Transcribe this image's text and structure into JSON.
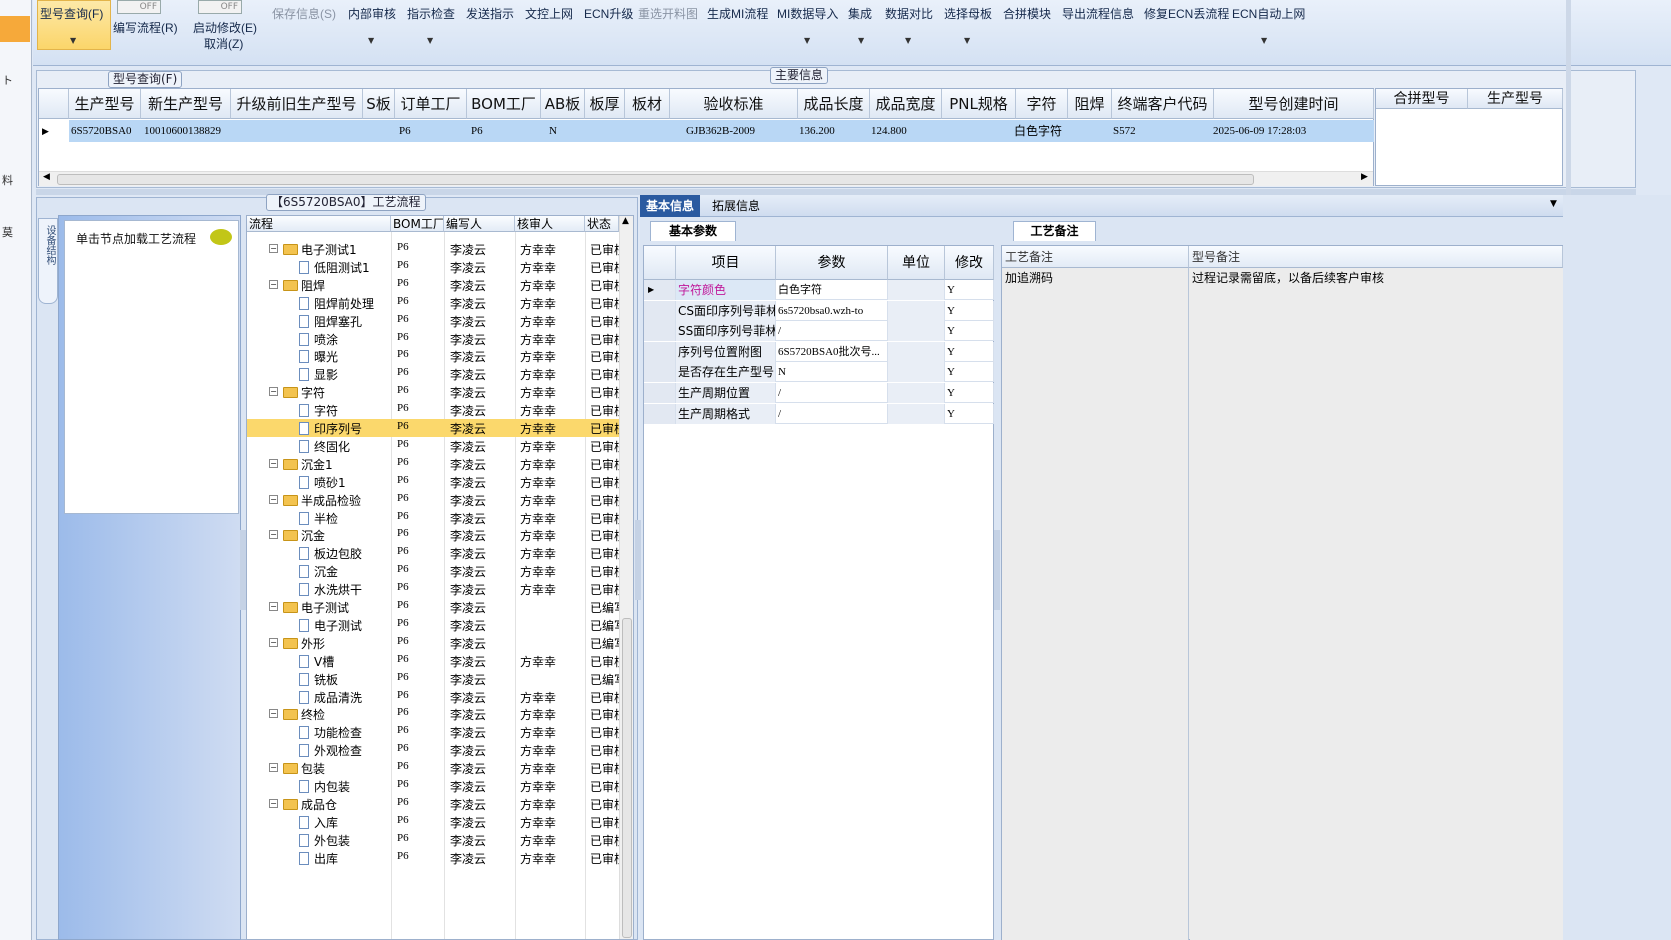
{
  "ribbon": {
    "model_query": "型号查询(F)",
    "edit_flow": "编写流程(R)",
    "switch_off": "OFF",
    "start_modify": "启动修改(E)",
    "cancel": "取消(Z)",
    "save_info": "保存信息(S)",
    "internal_review": "内部审核",
    "instruction_check": "指示检查",
    "send_instruction": "发送指示",
    "doc_upload": "文控上网",
    "ecn_upgrade": "ECN升级",
    "reselect_cutting": "重选开料图",
    "generate_mi": "生成MI流程",
    "mi_import": "MI数据导入",
    "integrate": "集成",
    "data_compare": "数据对比",
    "select_mother": "选择母板",
    "merge_module": "合拼模块",
    "export_flow": "导出流程信息",
    "repair_ecn": "修复ECN丢流程",
    "ecn_auto": "ECN自动上网"
  },
  "model_query_tab": "型号查询(F)",
  "main_info": {
    "title": "主要信息",
    "columns": [
      "生产型号",
      "新生产型号",
      "升级前旧生产型号",
      "S板",
      "订单工厂",
      "BOM工厂",
      "AB板",
      "板厚",
      "板材",
      "验收标准",
      "成品长度",
      "成品宽度",
      "PNL规格",
      "字符",
      "阻焊",
      "终端客户代码",
      "型号创建时间"
    ],
    "row": {
      "prod_model": "6S5720BSA0",
      "new_model": "10010600138829",
      "order_factory": "P6",
      "bom_factory": "P6",
      "ab_board": "N",
      "standard": "GJB362B-2009",
      "length": "136.200",
      "width": "124.800",
      "character": "白色字符",
      "customer": "S572",
      "created": "2025-06-09 17:28:03"
    },
    "merge_columns": [
      "合拼型号",
      "生产型号"
    ]
  },
  "process": {
    "title": "【6S5720BSA0】工艺流程",
    "vertical_tab": "设备结构",
    "click_hint": "单击节点加载工艺流程",
    "columns": [
      "流程",
      "BOM工厂",
      "编写人",
      "核审人",
      "状态"
    ],
    "rows": [
      {
        "name": "电子测试1",
        "type": "folder",
        "factory": "P6",
        "writer": "李凌云",
        "reviewer": "方幸幸",
        "status": "已审核"
      },
      {
        "name": "低阻测试1",
        "type": "doc",
        "factory": "P6",
        "writer": "李凌云",
        "reviewer": "方幸幸",
        "status": "已审核"
      },
      {
        "name": "阻焊",
        "type": "folder",
        "factory": "P6",
        "writer": "李凌云",
        "reviewer": "方幸幸",
        "status": "已审核"
      },
      {
        "name": "阻焊前处理",
        "type": "doc",
        "factory": "P6",
        "writer": "李凌云",
        "reviewer": "方幸幸",
        "status": "已审核"
      },
      {
        "name": "阻焊塞孔",
        "type": "doc",
        "factory": "P6",
        "writer": "李凌云",
        "reviewer": "方幸幸",
        "status": "已审核"
      },
      {
        "name": "喷涂",
        "type": "doc",
        "factory": "P6",
        "writer": "李凌云",
        "reviewer": "方幸幸",
        "status": "已审核"
      },
      {
        "name": "曝光",
        "type": "doc",
        "factory": "P6",
        "writer": "李凌云",
        "reviewer": "方幸幸",
        "status": "已审核"
      },
      {
        "name": "显影",
        "type": "doc",
        "factory": "P6",
        "writer": "李凌云",
        "reviewer": "方幸幸",
        "status": "已审核"
      },
      {
        "name": "字符",
        "type": "folder",
        "factory": "P6",
        "writer": "李凌云",
        "reviewer": "方幸幸",
        "status": "已审核"
      },
      {
        "name": "字符",
        "type": "doc",
        "factory": "P6",
        "writer": "李凌云",
        "reviewer": "方幸幸",
        "status": "已审核"
      },
      {
        "name": "印序列号",
        "type": "doc",
        "factory": "P6",
        "writer": "李凌云",
        "reviewer": "方幸幸",
        "status": "已审核",
        "selected": true
      },
      {
        "name": "终固化",
        "type": "doc",
        "factory": "P6",
        "writer": "李凌云",
        "reviewer": "方幸幸",
        "status": "已审核"
      },
      {
        "name": "沉金1",
        "type": "folder",
        "factory": "P6",
        "writer": "李凌云",
        "reviewer": "方幸幸",
        "status": "已审核"
      },
      {
        "name": "喷砂1",
        "type": "doc",
        "factory": "P6",
        "writer": "李凌云",
        "reviewer": "方幸幸",
        "status": "已审核"
      },
      {
        "name": "半成品检验",
        "type": "folder",
        "factory": "P6",
        "writer": "李凌云",
        "reviewer": "方幸幸",
        "status": "已审核"
      },
      {
        "name": "半检",
        "type": "doc",
        "factory": "P6",
        "writer": "李凌云",
        "reviewer": "方幸幸",
        "status": "已审核"
      },
      {
        "name": "沉金",
        "type": "folder",
        "factory": "P6",
        "writer": "李凌云",
        "reviewer": "方幸幸",
        "status": "已审核"
      },
      {
        "name": "板边包胶",
        "type": "doc",
        "factory": "P6",
        "writer": "李凌云",
        "reviewer": "方幸幸",
        "status": "已审核"
      },
      {
        "name": "沉金",
        "type": "doc",
        "factory": "P6",
        "writer": "李凌云",
        "reviewer": "方幸幸",
        "status": "已审核"
      },
      {
        "name": "水洗烘干",
        "type": "doc",
        "factory": "P6",
        "writer": "李凌云",
        "reviewer": "方幸幸",
        "status": "已审核"
      },
      {
        "name": "电子测试",
        "type": "folder",
        "factory": "P6",
        "writer": "李凌云",
        "reviewer": "",
        "status": "已编写"
      },
      {
        "name": "电子测试",
        "type": "doc",
        "factory": "P6",
        "writer": "李凌云",
        "reviewer": "",
        "status": "已编写"
      },
      {
        "name": "外形",
        "type": "folder",
        "factory": "P6",
        "writer": "李凌云",
        "reviewer": "",
        "status": "已编写"
      },
      {
        "name": "V槽",
        "type": "doc",
        "factory": "P6",
        "writer": "李凌云",
        "reviewer": "方幸幸",
        "status": "已审核"
      },
      {
        "name": "铣板",
        "type": "doc",
        "factory": "P6",
        "writer": "李凌云",
        "reviewer": "",
        "status": "已编写"
      },
      {
        "name": "成品清洗",
        "type": "doc",
        "factory": "P6",
        "writer": "李凌云",
        "reviewer": "方幸幸",
        "status": "已审核"
      },
      {
        "name": "终检",
        "type": "folder",
        "factory": "P6",
        "writer": "李凌云",
        "reviewer": "方幸幸",
        "status": "已审核"
      },
      {
        "name": "功能检查",
        "type": "doc",
        "factory": "P6",
        "writer": "李凌云",
        "reviewer": "方幸幸",
        "status": "已审核"
      },
      {
        "name": "外观检查",
        "type": "doc",
        "factory": "P6",
        "writer": "李凌云",
        "reviewer": "方幸幸",
        "status": "已审核"
      },
      {
        "name": "包装",
        "type": "folder",
        "factory": "P6",
        "writer": "李凌云",
        "reviewer": "方幸幸",
        "status": "已审核"
      },
      {
        "name": "内包装",
        "type": "doc",
        "factory": "P6",
        "writer": "李凌云",
        "reviewer": "方幸幸",
        "status": "已审核"
      },
      {
        "name": "成品仓",
        "type": "folder",
        "factory": "P6",
        "writer": "李凌云",
        "reviewer": "方幸幸",
        "status": "已审核"
      },
      {
        "name": "入库",
        "type": "doc",
        "factory": "P6",
        "writer": "李凌云",
        "reviewer": "方幸幸",
        "status": "已审核"
      },
      {
        "name": "外包装",
        "type": "doc",
        "factory": "P6",
        "writer": "李凌云",
        "reviewer": "方幸幸",
        "status": "已审核"
      },
      {
        "name": "出库",
        "type": "doc",
        "factory": "P6",
        "writer": "李凌云",
        "reviewer": "方幸幸",
        "status": "已审核"
      }
    ]
  },
  "tabs": {
    "basic": "基本信息",
    "extended": "拓展信息",
    "basic_params": "基本参数",
    "process_notes": "工艺备注"
  },
  "params": {
    "columns": [
      "项目",
      "参数",
      "单位",
      "修改"
    ],
    "rows": [
      {
        "item": "字符颜色",
        "value": "白色字符",
        "unit": "",
        "modify": "Y",
        "highlight": true
      },
      {
        "item": "CS面印序列号菲林",
        "value": "6s5720bsa0.wzh-to",
        "unit": "",
        "modify": "Y"
      },
      {
        "item": "SS面印序列号菲林",
        "value": "/",
        "unit": "",
        "modify": "Y"
      },
      {
        "item": "序列号位置附图",
        "value": "6S5720BSA0批次号...",
        "unit": "",
        "modify": "Y"
      },
      {
        "item": "是否存在生产型号",
        "value": "N",
        "unit": "",
        "modify": "Y"
      },
      {
        "item": "生产周期位置",
        "value": "/",
        "unit": "",
        "modify": "Y"
      },
      {
        "item": "生产周期格式",
        "value": "/",
        "unit": "",
        "modify": "Y"
      }
    ]
  },
  "notes": {
    "col1": "工艺备注",
    "col2": "型号备注",
    "process_note": "加追溯码",
    "model_note": "过程记录需留底，以备后续客户审核"
  },
  "left_strip": {
    "c1": "ト",
    "c2": "料",
    "c3": "莫"
  },
  "colors": {
    "selection": "#fbd86c",
    "row_select": "#b9d7f5",
    "tab_active": "#2a5aa0",
    "highlight_text": "#c0189a"
  }
}
